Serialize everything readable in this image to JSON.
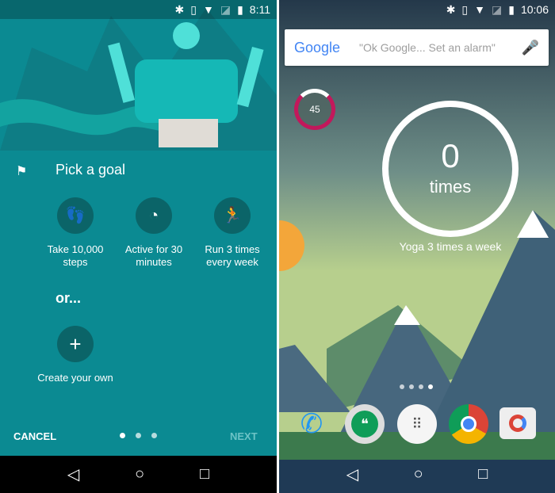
{
  "left": {
    "status": {
      "time": "8:11",
      "icons": [
        "bluetooth-icon",
        "vibrate-icon",
        "wifi-icon",
        "no-sim-icon",
        "battery-charging-icon"
      ]
    },
    "title": "Pick a goal",
    "goals": [
      {
        "label": "Take 10,000 steps",
        "icon": "footsteps-icon"
      },
      {
        "label": "Active for 30 minutes",
        "icon": "timer-icon"
      },
      {
        "label": "Run 3 times every week",
        "icon": "run-icon"
      }
    ],
    "or": "or...",
    "create": {
      "label": "Create your own",
      "icon": "plus-icon"
    },
    "cancel": "CANCEL",
    "next": "NEXT",
    "page_dots": 3,
    "current_page": 1,
    "bg": "#0b8a92"
  },
  "right": {
    "status": {
      "time": "10:06",
      "icons": [
        "bluetooth-icon",
        "vibrate-icon",
        "wifi-icon",
        "no-sim-icon",
        "battery-icon"
      ]
    },
    "search": {
      "logo": "Google",
      "placeholder": "\"Ok Google... Set an alarm\""
    },
    "small_widget": {
      "value": "45"
    },
    "goal_widget": {
      "count": "0",
      "unit": "times",
      "caption": "Yoga 3 times a week"
    },
    "dock": [
      "phone",
      "hangouts",
      "app-drawer",
      "chrome",
      "camera"
    ]
  },
  "nav": [
    "back",
    "home",
    "recents"
  ]
}
